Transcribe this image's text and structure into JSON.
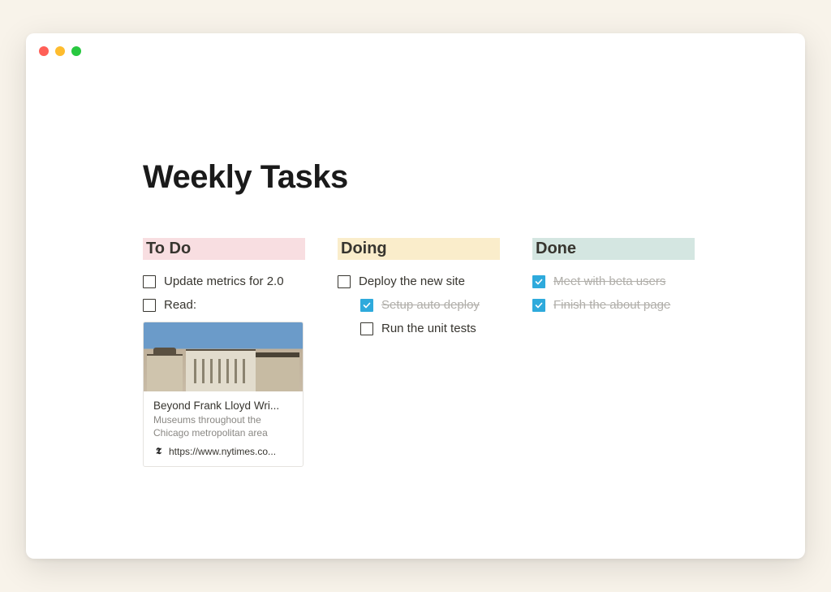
{
  "page": {
    "title": "Weekly Tasks"
  },
  "columns": {
    "todo": {
      "header": "To Do",
      "tasks": [
        {
          "label": "Update metrics for 2.0",
          "checked": false
        },
        {
          "label": "Read:",
          "checked": false
        }
      ],
      "bookmark": {
        "title": "Beyond Frank Lloyd Wri...",
        "description": "Museums throughout the Chicago metropolitan area",
        "url": "https://www.nytimes.co...",
        "favicon_label": "nyt-icon"
      }
    },
    "doing": {
      "header": "Doing",
      "tasks": [
        {
          "label": "Deploy the new site",
          "checked": false,
          "subtasks": [
            {
              "label": "Setup auto deploy",
              "checked": true
            },
            {
              "label": "Run the unit tests",
              "checked": false
            }
          ]
        }
      ]
    },
    "done": {
      "header": "Done",
      "tasks": [
        {
          "label": "Meet with beta users",
          "checked": true
        },
        {
          "label": "Finish the about page",
          "checked": true
        }
      ]
    }
  },
  "colors": {
    "todo_header": "#f8dee1",
    "doing_header": "#faedcb",
    "done_header": "#d4e6e1",
    "check_done": "#2eaadc"
  }
}
